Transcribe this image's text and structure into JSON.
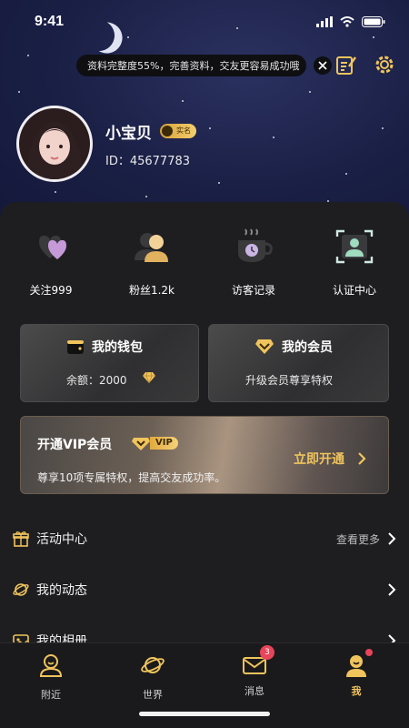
{
  "status": {
    "time": "9:41"
  },
  "notice": {
    "text": "资料完整度55%，完善资料，交友更容易成功哦"
  },
  "profile": {
    "name": "小宝贝",
    "badge": "实名",
    "id_text": "ID：45677783"
  },
  "quick_actions": [
    {
      "label": "关注999",
      "icon": "hearts-icon"
    },
    {
      "label": "粉丝1.2k",
      "icon": "fans-icon"
    },
    {
      "label": "访客记录",
      "icon": "visitor-cup-icon"
    },
    {
      "label": "认证中心",
      "icon": "verify-icon"
    }
  ],
  "wallet": {
    "title": "我的钱包",
    "balance": "余额：2000"
  },
  "membership": {
    "title": "我的会员",
    "subtitle": "升级会员尊享特权"
  },
  "vip_banner": {
    "title": "开通VIP会员",
    "badge": "VIP",
    "desc": "尊享10项专属特权，提高交友成功率。",
    "cta": "立即开通"
  },
  "menu": [
    {
      "label": "活动中心",
      "more": "查看更多",
      "icon": "gift-icon"
    },
    {
      "label": "我的动态",
      "more": "",
      "icon": "planet-icon"
    },
    {
      "label": "我的相册",
      "more": "",
      "icon": "album-icon"
    }
  ],
  "tabs": [
    {
      "label": "附近",
      "icon": "nearby-icon"
    },
    {
      "label": "世界",
      "icon": "world-icon"
    },
    {
      "label": "消息",
      "icon": "message-icon",
      "badge": "3"
    },
    {
      "label": "我",
      "icon": "me-icon"
    }
  ],
  "colors": {
    "gold": "#f0c45c",
    "panel": "#1e1e20",
    "hero": "#1a1f45",
    "badge_red": "#e8445a"
  }
}
